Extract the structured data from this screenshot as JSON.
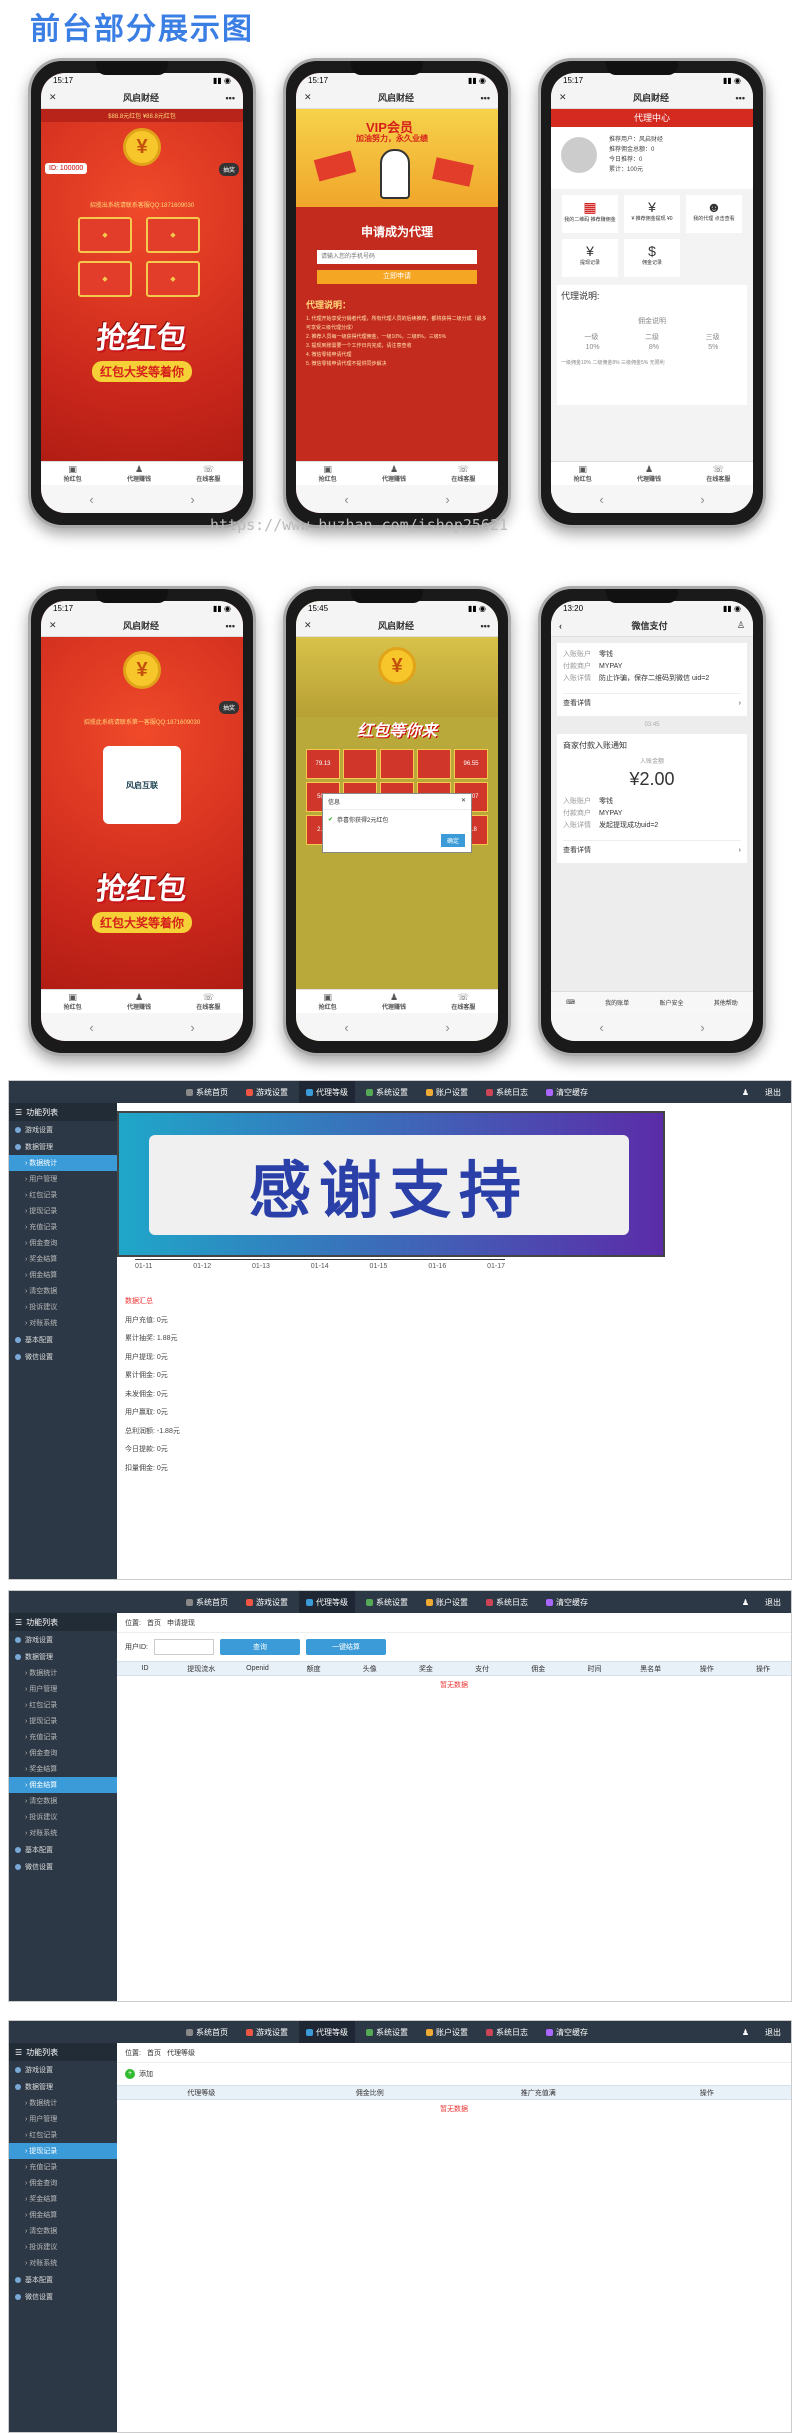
{
  "title": "前台部分展示图",
  "watermark": "https://www.huzhan.com/ishop25621",
  "phones": {
    "p1": {
      "time": "15:17",
      "app": "风启财经",
      "ticker": "$88.8元红包  ¥88.8元红包",
      "id_label": "ID: 100000",
      "btn": "抽奖",
      "promo": "招揽出系统请联系客服QQ:1871609030",
      "big": "抢红包",
      "sub": "红包大奖等着你",
      "tabs": [
        "抢红包",
        "代理赚钱",
        "在线客服"
      ]
    },
    "p2": {
      "time": "15:17",
      "app": "风启财经",
      "vip": "VIP会员",
      "slogan": "加油努力，永久业绩",
      "apply": "申请成为代理",
      "placeholder": "请输入您的手机号码",
      "submit": "立即申请",
      "notice_title": "代理说明：",
      "notes": [
        "1. 代理开始享受分销者代理，所有代理人员的后续推荐，都将获得二级分成（最多可享受三级代理分成）",
        "2. 推荐人员每一级获得代理佣金，一级10%，二级8%，三级5%",
        "3. 提现到账需要一个工作日内完成，请注意查收",
        "4. 微信零钱申请代理",
        "5. 微信零钱申请代理不提供同步解决"
      ],
      "tabs": [
        "抢红包",
        "代理赚钱",
        "在线客服"
      ]
    },
    "p3": {
      "time": "15:17",
      "app": "风启财经",
      "center": "代理中心",
      "name": "推荐用户：风启财经",
      "lines": [
        "推荐佣金总额：0",
        "今日推荐：0",
        "累计：100元"
      ],
      "grid": [
        "我的二维码 推荐赚佣金",
        "¥ 推荐佣金提现 ¥0",
        "我的代理 点击查看",
        "提现记录",
        "佣金记录"
      ],
      "desc": "代理说明:",
      "small": "佣金说明",
      "levels": [
        "一级",
        "二级",
        "三级"
      ],
      "rates": [
        "10%",
        "8%",
        "5%"
      ],
      "foot": "一级佣金10% 二级佣金8% 三级佣金5% 无限利",
      "tabs": [
        "抢红包",
        "代理赚钱",
        "在线客服"
      ]
    },
    "p4": {
      "time": "15:17",
      "app": "风启财经",
      "promo": "招揽此系统请联系第一客服QQ:1871609030",
      "logo": "风启互联",
      "btn": "抽奖",
      "big": "抢红包",
      "sub": "红包大奖等着你",
      "tabs": [
        "抢红包",
        "代理赚钱",
        "在线客服"
      ]
    },
    "p5": {
      "time": "15:45",
      "app": "风启财经",
      "banner": "红包等你来",
      "dialog_title": "信息",
      "dialog_msg": "恭喜你获得2元红包",
      "ok": "确定",
      "cells": [
        "79.13",
        "",
        "",
        "",
        "96.55",
        "50.8",
        "58.04",
        "94.38",
        "1.42",
        "68.07",
        "2.76",
        "29.34",
        "70.56",
        "11.51",
        "56.8"
      ],
      "tabs": [
        "抢红包",
        "代理赚钱",
        "在线客服"
      ]
    },
    "p6": {
      "time": "13:20",
      "title": "微信支付",
      "rows": [
        [
          "入账账户",
          "零钱"
        ],
        [
          "付款商户",
          "MYPAY"
        ],
        [
          "入账详情",
          "防止诈骗，保存二维码到微信 uid=2"
        ]
      ],
      "view": "查看详情",
      "ts": "03:45",
      "notice": "商家付款入账通知",
      "amount_label": "入账金额",
      "amount": "¥2.00",
      "rows2": [
        [
          "入账账户",
          "零钱"
        ],
        [
          "付款商户",
          "MYPAY"
        ],
        [
          "入账详情",
          "发起提现成功uid=2"
        ]
      ],
      "view2": "查看详情",
      "tabs": [
        "我的账单",
        "账户安全",
        "其他帮助"
      ]
    }
  },
  "admin_nav": [
    "系统首页",
    "游戏设置",
    "代理等级",
    "系统设置",
    "账户设置",
    "系统日志",
    "清空缓存"
  ],
  "logout": "退出",
  "admin1": {
    "side_head": "功能列表",
    "groups": [
      "游戏设置",
      "数据管理"
    ],
    "items": [
      "数据统计",
      "用户管理",
      "红包记录",
      "提现记录",
      "充值记录",
      "佣金查询",
      "奖金结算",
      "佣金结算",
      "清空数据",
      "投诉建议",
      "对账系统"
    ],
    "groups2": [
      "基本配置",
      "微信设置"
    ],
    "thanks": "感谢支持",
    "dates": [
      "01-11",
      "01-12",
      "01-13",
      "01-14",
      "01-15",
      "01-16",
      "01-17"
    ],
    "stats_title": "数据汇总",
    "stats": [
      "用户充值: 0元",
      "累计抽奖: 1.88元",
      "用户提现: 0元",
      "累计佣金: 0元",
      "未发佣金: 0元",
      "用户赢取: 0元",
      "总利润额: -1.88元",
      "今日提款: 0元",
      "扣量佣金: 0元"
    ]
  },
  "admin2": {
    "crumb": [
      "位置:",
      "首页",
      "申请提现"
    ],
    "user_label": "用户ID:",
    "query": "查询",
    "one": "一键结算",
    "cols": [
      "ID",
      "提现流水",
      "Openid",
      "额度",
      "头像",
      "奖金",
      "支付",
      "佣金",
      "时间",
      "黑名单",
      "操作",
      "操作"
    ],
    "empty": "暂无数据"
  },
  "admin3": {
    "crumb": [
      "位置:",
      "首页",
      "代理等级"
    ],
    "add": "添加",
    "cols": [
      "代理等级",
      "佣金比例",
      "推广充值满",
      "操作"
    ],
    "empty": "暂无数据"
  }
}
